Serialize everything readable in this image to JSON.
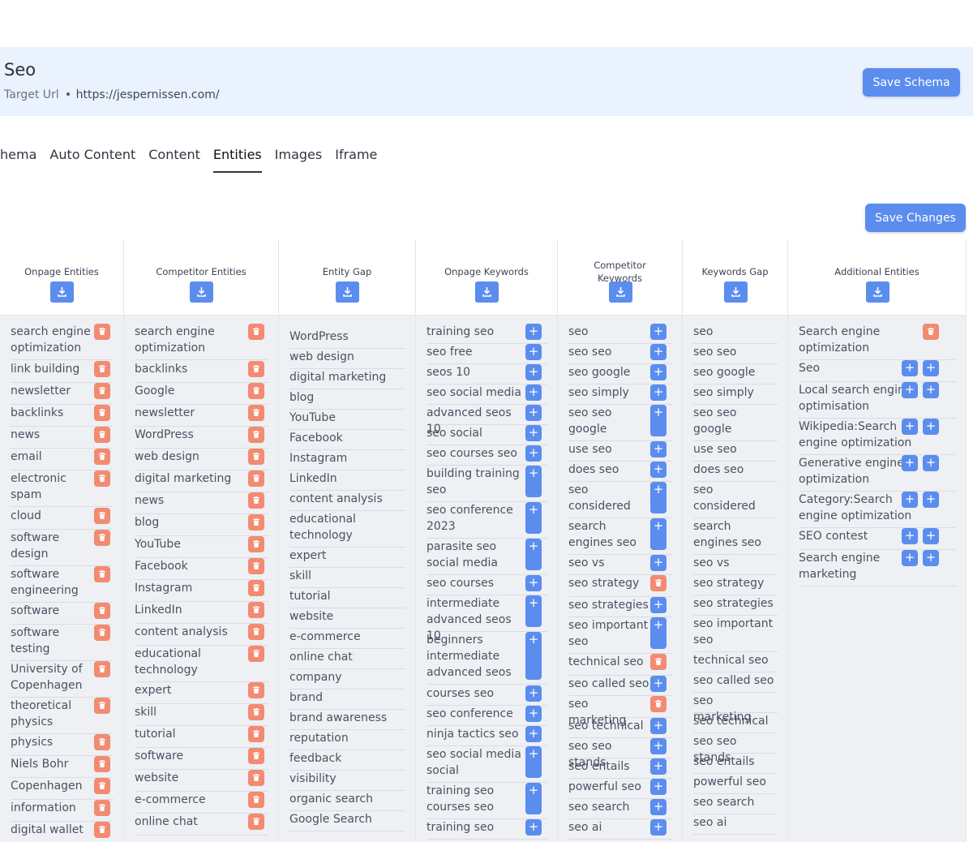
{
  "header": {
    "title": "Seo",
    "target_label": "Target Url",
    "target_url": "https://jespernissen.com/",
    "save_schema_label": "Save Schema"
  },
  "tabs": [
    "hema",
    "Auto Content",
    "Content",
    "Entities",
    "Images",
    "Iframe"
  ],
  "active_tab": "Entities",
  "save_changes_label": "Save Changes",
  "colors": {
    "accent": "#5b8def",
    "delete": "#f28b72",
    "header_bg": "#eaf2fd",
    "table_bg": "#eef0f4"
  },
  "columns": [
    {
      "title": "Onpage Entities",
      "action": "delete",
      "items": [
        "search engine optimization",
        "link building",
        "newsletter",
        "backlinks",
        "news",
        "email",
        "electronic spam",
        "cloud",
        "software design",
        "software engineering",
        "software",
        "software testing",
        "University of Copenhagen",
        "theoretical physics",
        "physics",
        "Niels Bohr",
        "Copenhagen",
        "information",
        "digital wallet"
      ]
    },
    {
      "title": "Competitor Entities",
      "action": "delete",
      "items": [
        "search engine optimization",
        "backlinks",
        "Google",
        "newsletter",
        "WordPress",
        "web design",
        "digital marketing",
        "news",
        "blog",
        "YouTube",
        "Facebook",
        "Instagram",
        "LinkedIn",
        "content analysis",
        "educational technology",
        "expert",
        "skill",
        "tutorial",
        "software",
        "website",
        "e-commerce",
        "online chat"
      ]
    },
    {
      "title": "Entity Gap",
      "action": "none",
      "items": [
        "WordPress",
        "web design",
        "digital marketing",
        "blog",
        "YouTube",
        "Facebook",
        "Instagram",
        "LinkedIn",
        "content analysis",
        "educational technology",
        "expert",
        "skill",
        "tutorial",
        "website",
        "e-commerce",
        "online chat",
        "company",
        "brand",
        "brand awareness",
        "reputation",
        "feedback",
        "visibility",
        "organic search",
        "Google Search"
      ]
    },
    {
      "title": "Onpage Keywords",
      "action": "add",
      "items": [
        "training seo",
        "seo free",
        "seos 10",
        "seo social media",
        "advanced seos 10",
        "seo social",
        "seo courses seo",
        "building training seo",
        "seo conference 2023",
        "parasite seo social media",
        "seo courses",
        "intermediate advanced seos 10",
        "beginners intermediate advanced seos",
        "courses seo",
        "seo conference",
        "ninja tactics seo",
        "seo social media social",
        "training seo courses seo",
        "training seo"
      ]
    },
    {
      "title": "Competitor Keywords",
      "action": "mixed",
      "items": [
        "seo",
        "seo seo",
        "seo google",
        "seo simply",
        "seo seo google",
        "use seo",
        "does seo",
        "seo considered",
        "search engines seo",
        "seo vs",
        "seo strategy",
        "seo strategies",
        "seo important seo",
        "technical seo",
        "seo called seo",
        "seo marketing",
        "seo technical",
        "seo seo stands",
        "seo entails",
        "powerful seo",
        "seo search",
        "seo ai"
      ]
    },
    {
      "title": "Keywords Gap",
      "action": "none",
      "items": [
        "seo",
        "seo seo",
        "seo google",
        "seo simply",
        "seo seo google",
        "use seo",
        "does seo",
        "seo considered",
        "search engines seo",
        "seo vs",
        "seo strategy",
        "seo strategies",
        "seo important seo",
        "technical seo",
        "seo called seo",
        "seo marketing",
        "seo technical",
        "seo seo stands",
        "seo entails",
        "powerful seo",
        "seo search",
        "seo ai"
      ]
    },
    {
      "title": "Additional Entities",
      "action": "mixed",
      "items": [
        "Search engine optimization",
        "Seo",
        "Local search engine optimisation",
        "Wikipedia:Search engine optimization",
        "Generative engine optimization",
        "Category:Search engine optimization",
        "SEO contest",
        "Search engine marketing"
      ]
    }
  ]
}
